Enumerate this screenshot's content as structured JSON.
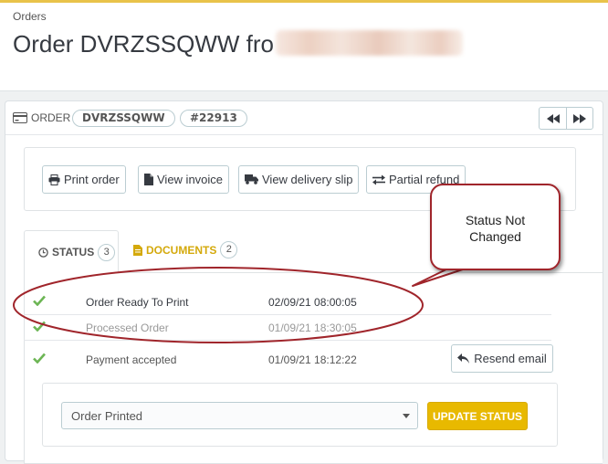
{
  "header": {
    "breadcrumb": "Orders",
    "title": "Order DVRZSSQWW fro"
  },
  "order": {
    "label": "ORDER",
    "reference": "DVRZSSQWW",
    "number": "#22913"
  },
  "actions": {
    "print_order": "Print order",
    "view_invoice": "View invoice",
    "view_delivery_slip": "View delivery slip",
    "partial_refund": "Partial refund"
  },
  "tabs": {
    "status": {
      "label": "STATUS",
      "count": "3"
    },
    "documents": {
      "label": "DOCUMENTS",
      "count": "2"
    }
  },
  "history": [
    {
      "status": "Order Ready To Print",
      "date": "02/09/21 08:00:05"
    },
    {
      "status": "Processed Order",
      "date": "01/09/21 18:30:05"
    },
    {
      "status": "Payment accepted",
      "date": "01/09/21 18:12:22"
    }
  ],
  "resend_email": "Resend email",
  "update": {
    "selected": "Order Printed",
    "button": "UPDATE STATUS"
  },
  "callout": {
    "line1": "Status Not",
    "line2": "Changed"
  },
  "colors": {
    "accent": "#e8b900",
    "check": "#6cb554",
    "annotation": "#a0252b"
  }
}
